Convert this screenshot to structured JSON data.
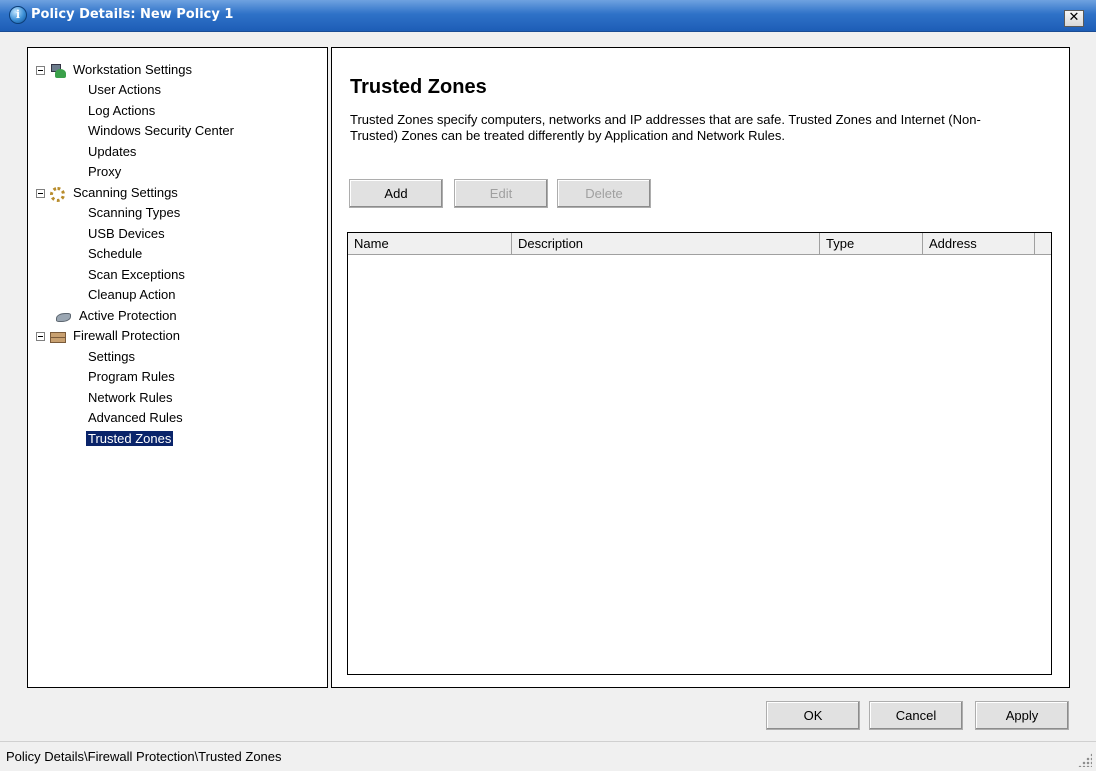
{
  "window": {
    "title": "Policy Details: New Policy 1",
    "close_glyph": "✕"
  },
  "tree": {
    "items": [
      {
        "level": 0,
        "label": "Workstation Settings",
        "icon": "workstation-icon",
        "expandable": true
      },
      {
        "level": 1,
        "label": "User Actions"
      },
      {
        "level": 1,
        "label": "Log Actions"
      },
      {
        "level": 1,
        "label": "Windows Security Center"
      },
      {
        "level": 1,
        "label": "Updates"
      },
      {
        "level": 1,
        "label": "Proxy"
      },
      {
        "level": 0,
        "label": "Scanning Settings",
        "icon": "scanning-icon",
        "expandable": true
      },
      {
        "level": 1,
        "label": "Scanning Types"
      },
      {
        "level": 1,
        "label": "USB Devices"
      },
      {
        "level": 1,
        "label": "Schedule"
      },
      {
        "level": 1,
        "label": "Scan Exceptions"
      },
      {
        "level": 1,
        "label": "Cleanup Action"
      },
      {
        "level": 0,
        "label": "Active Protection",
        "icon": "active-protection-icon",
        "expandable": false
      },
      {
        "level": 0,
        "label": "Firewall Protection",
        "icon": "firewall-icon",
        "expandable": true
      },
      {
        "level": 1,
        "label": "Settings"
      },
      {
        "level": 1,
        "label": "Program Rules"
      },
      {
        "level": 1,
        "label": "Network Rules"
      },
      {
        "level": 1,
        "label": "Advanced Rules"
      },
      {
        "level": 1,
        "label": "Trusted Zones",
        "selected": true
      }
    ]
  },
  "content": {
    "heading": "Trusted Zones",
    "description": "Trusted Zones specify computers, networks and IP addresses that are safe. Trusted Zones and Internet (Non-Trusted) Zones can be treated differently by Application and Network Rules.",
    "buttons": {
      "add": "Add",
      "edit": "Edit",
      "delete": "Delete"
    },
    "columns": [
      "Name",
      "Description",
      "Type",
      "Address"
    ],
    "rows": []
  },
  "footer": {
    "ok": "OK",
    "cancel": "Cancel",
    "apply": "Apply"
  },
  "status": {
    "path": "Policy Details\\Firewall Protection\\Trusted Zones"
  },
  "colors": {
    "titlebar": "#2f72c8",
    "selection": "#0a246a"
  }
}
